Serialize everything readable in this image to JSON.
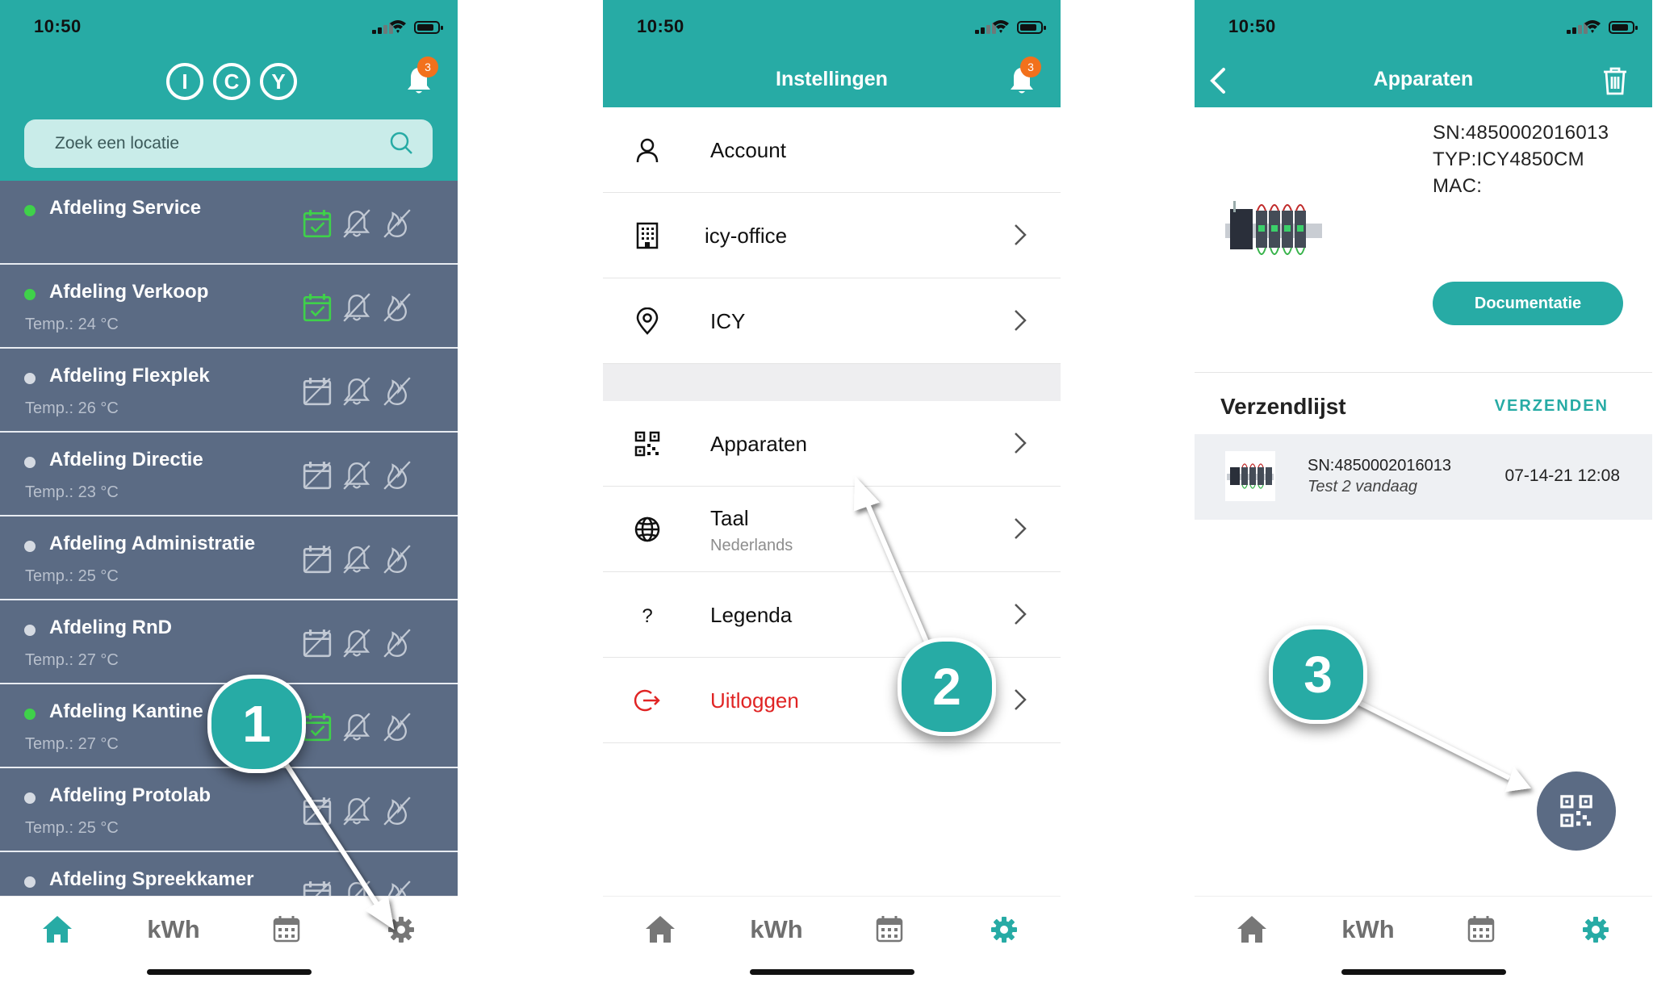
{
  "status": {
    "time": "10:50"
  },
  "screen1": {
    "logo_letters": [
      "I",
      "C",
      "Y"
    ],
    "badge_count": "3",
    "search_placeholder": "Zoek een locatie",
    "rows": [
      {
        "name": "Afdeling Service",
        "temp": "",
        "online": true,
        "calendar_active": true
      },
      {
        "name": "Afdeling Verkoop",
        "temp": "Temp.: 24 °C",
        "online": true,
        "calendar_active": true
      },
      {
        "name": "Afdeling Flexplek",
        "temp": "Temp.: 26 °C",
        "online": false,
        "calendar_active": false
      },
      {
        "name": "Afdeling Directie",
        "temp": "Temp.: 23 °C",
        "online": false,
        "calendar_active": false
      },
      {
        "name": "Afdeling Administratie",
        "temp": "Temp.: 25 °C",
        "online": false,
        "calendar_active": false
      },
      {
        "name": "Afdeling RnD",
        "temp": "Temp.: 27 °C",
        "online": false,
        "calendar_active": false
      },
      {
        "name": "Afdeling Kantine",
        "temp": "Temp.: 27 °C",
        "online": true,
        "calendar_active": true
      },
      {
        "name": "Afdeling Protolab",
        "temp": "Temp.: 25 °C",
        "online": false,
        "calendar_active": false
      },
      {
        "name": "Afdeling Spreekkamer",
        "temp": "",
        "online": false,
        "calendar_active": false
      }
    ]
  },
  "screen2": {
    "title": "Instellingen",
    "badge_count": "3",
    "items": [
      {
        "icon": "user-icon",
        "label": "Account",
        "sublabel": ""
      },
      {
        "icon": "building-icon",
        "label": "icy-office",
        "sublabel": ""
      },
      {
        "icon": "location-pin-icon",
        "label": "ICY",
        "sublabel": ""
      },
      {
        "icon": "qr-code-icon",
        "label": "Apparaten",
        "sublabel": ""
      },
      {
        "icon": "globe-icon",
        "label": "Taal",
        "sublabel": "Nederlands"
      },
      {
        "icon": "question-icon",
        "label": "Legenda",
        "sublabel": ""
      },
      {
        "icon": "logout-icon",
        "label": "Uitloggen",
        "sublabel": ""
      }
    ]
  },
  "screen3": {
    "title": "Apparaten",
    "device": {
      "sn": "SN:4850002016013",
      "type": "TYP:ICY4850CM",
      "mac": "MAC:",
      "doc_button": "Documentatie"
    },
    "shipping": {
      "title": "Verzendlijst",
      "send_button": "VERZENDEN",
      "rows": [
        {
          "sn": "SN:4850002016013",
          "note": "Test 2 vandaag",
          "datetime": "07-14-21 12:08"
        }
      ]
    }
  },
  "nav": {
    "kwh_label": "kWh"
  },
  "annotations": [
    "1",
    "2",
    "3"
  ],
  "colors": {
    "accent": "#27aba5",
    "list_bg": "#5b6b84",
    "online": "#3fd14a",
    "badge": "#f2711c",
    "danger": "#e02424"
  }
}
